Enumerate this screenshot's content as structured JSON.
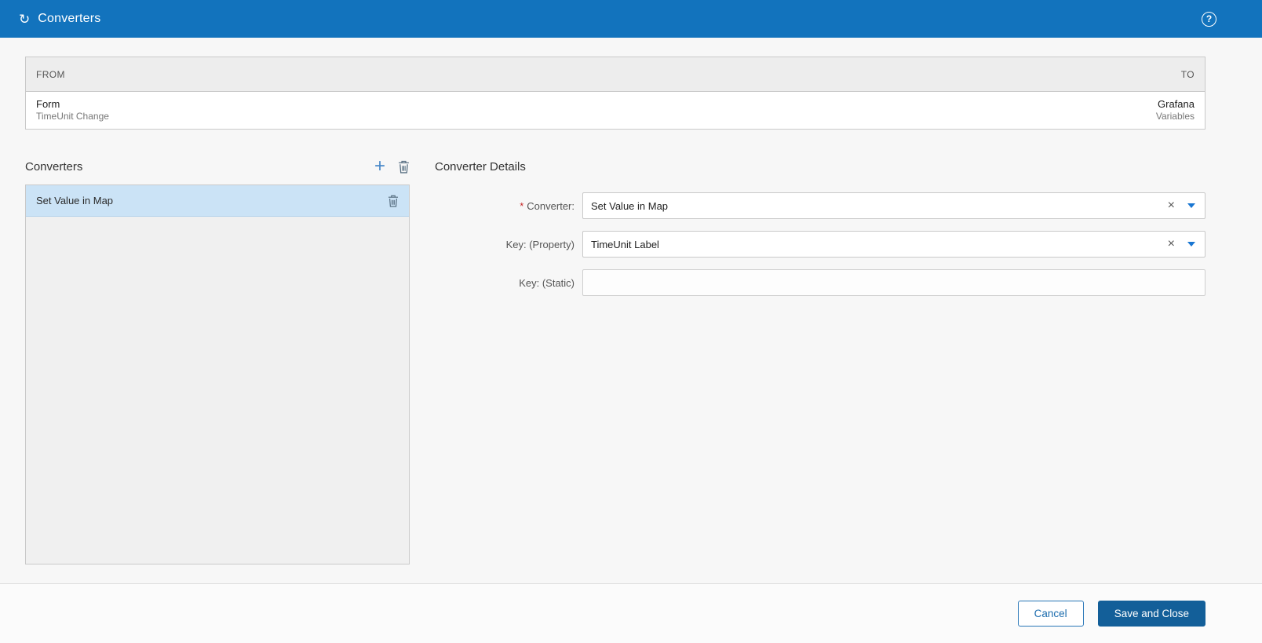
{
  "header": {
    "title": "Converters",
    "help_label": "?"
  },
  "icons": {
    "refresh": "↻",
    "add": "+",
    "clear": "×"
  },
  "mapping_table": {
    "from_header": "FROM",
    "to_header": "TO",
    "row": {
      "from_title": "Form",
      "from_subtitle": "TimeUnit Change",
      "to_title": "Grafana",
      "to_subtitle": "Variables"
    }
  },
  "converters_panel": {
    "title": "Converters",
    "items": [
      {
        "label": "Set Value in Map",
        "selected": true
      }
    ]
  },
  "details_panel": {
    "title": "Converter Details",
    "required_marker": "*",
    "fields": [
      {
        "label": "Converter:",
        "required": true,
        "value": "Set Value in Map"
      },
      {
        "label": "Key: (Property)",
        "required": false,
        "value": "TimeUnit Label"
      },
      {
        "label": "Key: (Static)",
        "required": false,
        "value": ""
      }
    ]
  },
  "footer": {
    "cancel_label": "Cancel",
    "save_label": "Save and Close"
  },
  "colors": {
    "header_bg": "#1273bd",
    "accent_blue": "#1976d2",
    "selected_item_bg": "#cbe3f6",
    "save_button_bg": "#135f99",
    "cancel_border": "#2a77b8",
    "required_red": "#c62828"
  }
}
